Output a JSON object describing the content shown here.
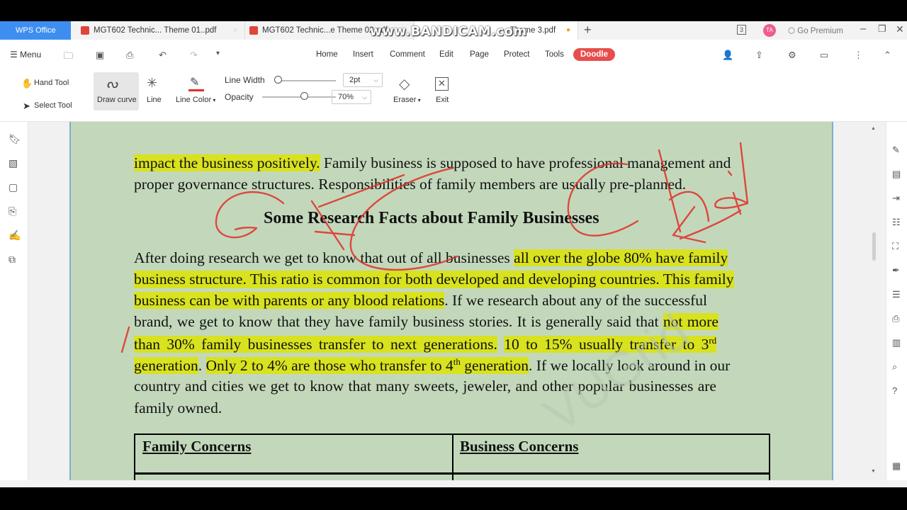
{
  "tabbar": {
    "app_tab": "WPS Office",
    "tabs": [
      {
        "label": "MGT602 Technic... Theme 01..pdf"
      },
      {
        "label": "MGT602 Technic...e Theme 02.pdf"
      },
      {
        "label": "...Theme 3.pdf"
      }
    ],
    "recorder_watermark": "www.BANDICAM.com",
    "avatar_initials": "TA",
    "premium_label": "Go Premium"
  },
  "menubar": {
    "menu_label": "Menu",
    "tabs": [
      "Home",
      "Insert",
      "Comment",
      "Edit",
      "Page",
      "Protect",
      "Tools",
      "Doodle"
    ]
  },
  "ribbon": {
    "hand_tool": "Hand Tool",
    "select_tool": "Select Tool",
    "draw_curve": "Draw curve",
    "line": "Line",
    "line_color": "Line Color",
    "line_width_label": "Line Width",
    "line_width_value": "2pt",
    "opacity_label": "Opacity",
    "opacity_value": "70%",
    "eraser": "Eraser",
    "exit": "Exit"
  },
  "document": {
    "line1_a": "impact the business positively.",
    "line1_b": " Family business is supposed to have professional management and",
    "line2": "proper governance structures.  Responsibilities of family members are usually pre-planned.",
    "heading": "Some Research Facts about Family Businesses",
    "p1_a": "After doing research we get to know that out of all businesses ",
    "p1_b": "all over the globe 80% have family",
    "p2": "business structure.  This ratio is common for both developed and developing countries.  This family",
    "p3_a": "business can be with parents or any blood relations",
    "p3_b": ". If we research about any of the successful",
    "p4_a": "brand, we get to know that they have family business stories.  It is generally said that ",
    "p4_b": "not more",
    "p5_a": "than 30% family businesses transfer to next generations.",
    "p5_b": " ",
    "p5_c": "10 to 15% usually transfer to 3",
    "p5_sup": "rd",
    "p6_a": "generation",
    "p6_b": ". ",
    "p6_c": "Only 2 to 4% are those who transfer to 4",
    "p6_sup": "th",
    "p6_d": " generation",
    "p6_e": ". If we locally look around in our",
    "p7": "country and cities we get to know that many sweets, jeweler, and other popular businesses are",
    "p8": "family owned.",
    "table_headers": [
      "Family Concerns",
      "Business Concerns"
    ]
  },
  "colors": {
    "highlight": "#d8e21e",
    "doodle_ink": "#e0302a",
    "page_bg": "#c3d8bb",
    "accent": "#3d8ef0"
  }
}
